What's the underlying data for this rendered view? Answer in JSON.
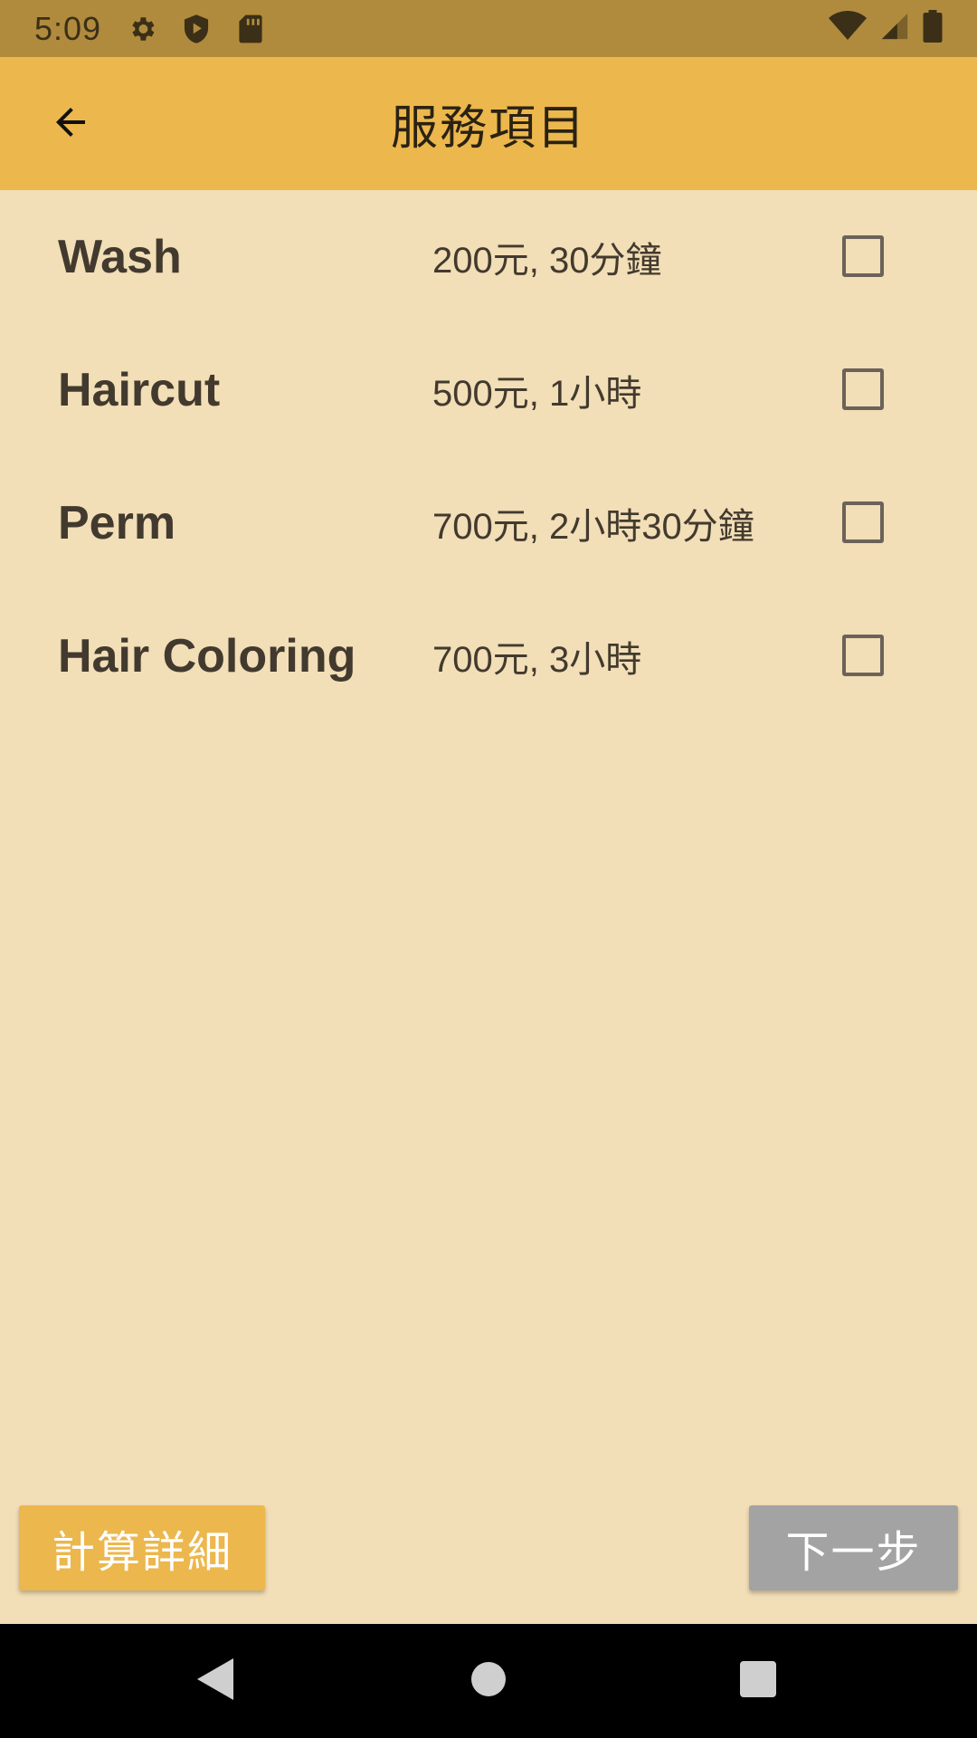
{
  "status_bar": {
    "time": "5:09",
    "left_icons": [
      "settings-icon",
      "shield-play-icon",
      "sd-card-icon"
    ],
    "right_icons": [
      "wifi-icon",
      "signal-icon",
      "battery-icon"
    ]
  },
  "app_bar": {
    "title": "服務項目",
    "back_icon": "arrow-left-icon"
  },
  "services": [
    {
      "name": "Wash",
      "price": "200元, 30分鐘",
      "checked": false
    },
    {
      "name": "Haircut",
      "price": "500元, 1小時",
      "checked": false
    },
    {
      "name": "Perm",
      "price": "700元, 2小時30分鐘",
      "checked": false
    },
    {
      "name": "Hair Coloring",
      "price": "700元, 3小時",
      "checked": false
    }
  ],
  "buttons": {
    "calculate_details": "計算詳細",
    "next_step": "下一步"
  },
  "nav_bar": {
    "icons": [
      "back-triangle-icon",
      "home-circle-icon",
      "recents-square-icon"
    ]
  },
  "colors": {
    "status_bar": "#b08b3d",
    "app_bar": "#ecb74c",
    "background": "#f2deb7",
    "next_button_disabled": "#a3a3a3",
    "text": "#423a2e"
  }
}
